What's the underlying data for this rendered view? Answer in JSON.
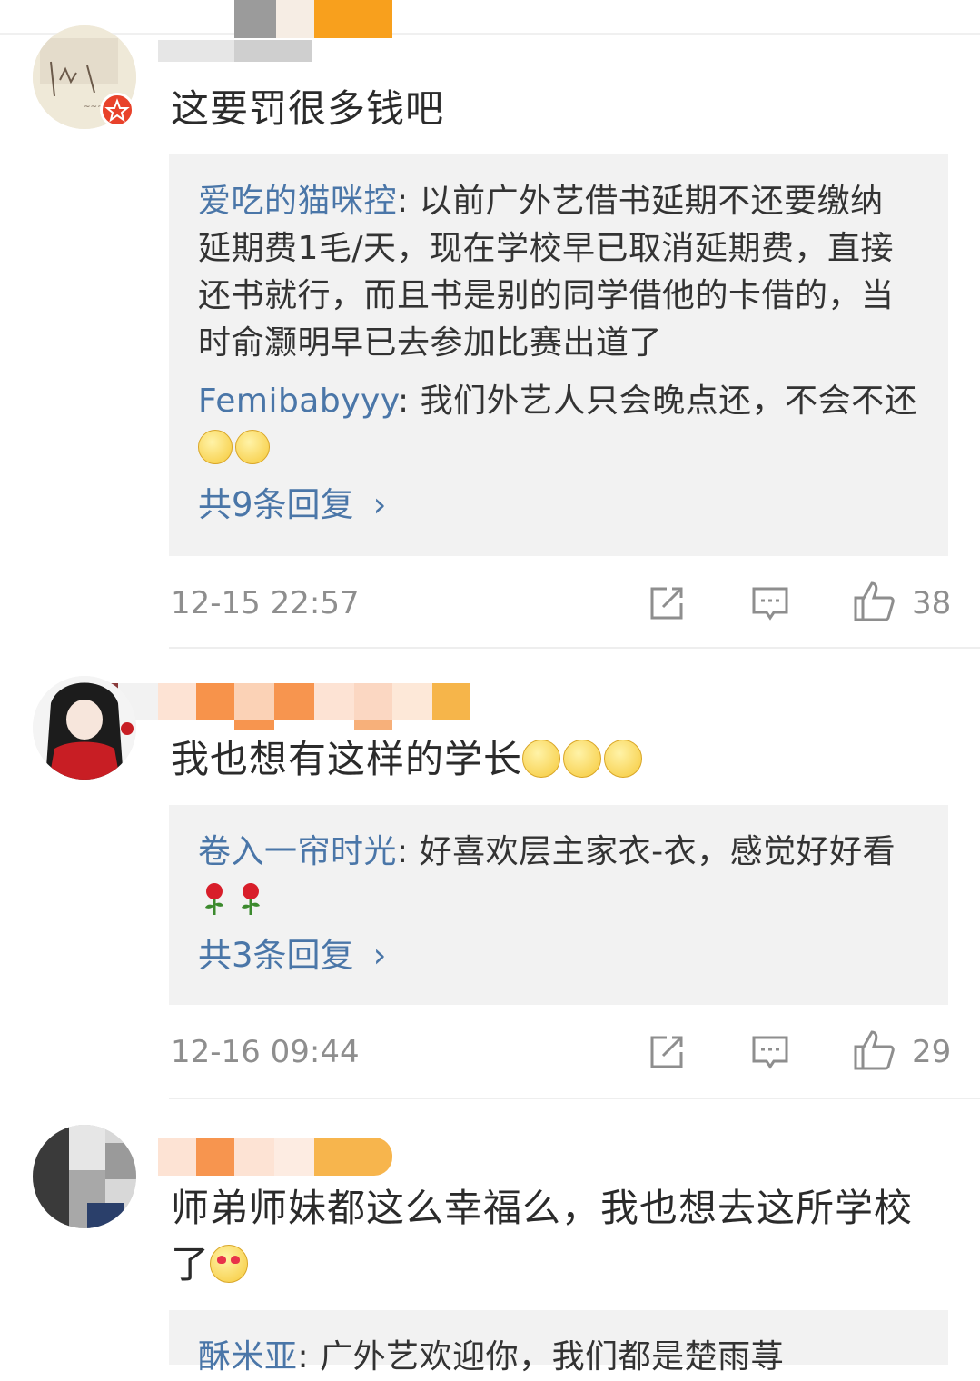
{
  "comments": [
    {
      "text": "这要罚很多钱吧",
      "replies": [
        {
          "user": "爱吃的猫咪控",
          "sep": ": ",
          "lines": [
            "以前广外艺借书延期不还要缴纳",
            "延期费1毛/天，现在学校早已取消延期费，直接",
            "还书就行，而且书是别的同学借他的卡借的，当",
            "时俞灏明早已去参加比赛出道了"
          ]
        },
        {
          "user": "Femibabyyy",
          "sep": ": ",
          "text": "我们外艺人只会晚点还，不会不还"
        }
      ],
      "more_label": "共9条回复",
      "chevron": "›",
      "time": "12-15 22:57",
      "likes": "38"
    },
    {
      "text": "我也想有这样的学长",
      "replies": [
        {
          "user": "卷入一帘时光",
          "sep": ": ",
          "text": "好喜欢层主家衣-衣，感觉好好看"
        }
      ],
      "more_label": "共3条回复",
      "chevron": "›",
      "time": "12-16 09:44",
      "likes": "29"
    },
    {
      "text_line1": "师弟师妹都这么幸福么，我也想去这所学校",
      "text_line2": "了",
      "replies": [
        {
          "user": "酥米亚",
          "sep": ": ",
          "text": "广外艺欢迎你，我们都是楚雨荨"
        }
      ]
    }
  ],
  "icons": {
    "repost": "repost-icon",
    "comment": "comment-icon",
    "like": "like-icon",
    "verified": "verified-badge-icon"
  },
  "colors": {
    "link": "#4a76a8",
    "reply_bg": "#f2f2f2",
    "meta": "#8e8e8e",
    "badge": "#e8422b"
  }
}
